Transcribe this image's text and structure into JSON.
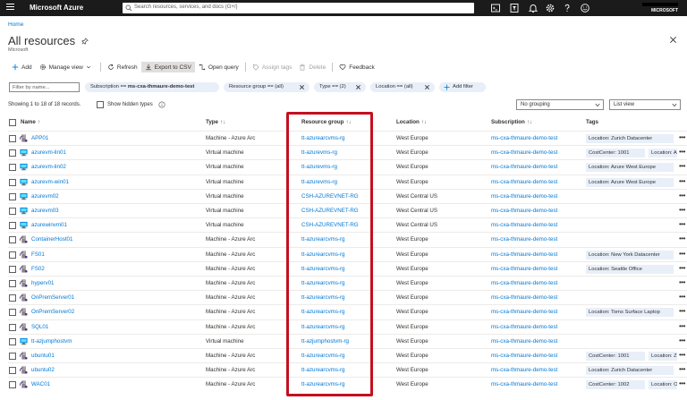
{
  "topbar": {
    "brand": "Microsoft Azure",
    "search_placeholder": "Search resources, services, and docs (G+/)",
    "tenant": "MICROSOFT"
  },
  "breadcrumb": "Home",
  "page": {
    "title": "All resources",
    "subtitle": "Microsoft"
  },
  "commands": {
    "add": "Add",
    "manage_view": "Manage view",
    "refresh": "Refresh",
    "export_csv": "Export to CSV",
    "open_query": "Open query",
    "assign_tags": "Assign tags",
    "delete": "Delete",
    "feedback": "Feedback"
  },
  "filters": {
    "placeholder": "Filter by name...",
    "subscription_label": "Subscription == ",
    "subscription_value": "ms-cxa-thmaure-demo-test",
    "resource_group": "Resource group == (all)",
    "type": "Type == (2)",
    "location": "Location == (all)",
    "add_filter": "Add filter"
  },
  "info": {
    "showing": "Showing 1 to 18 of 18 records.",
    "show_hidden": "Show hidden types",
    "grouping": "No grouping",
    "view": "List view"
  },
  "columns": {
    "name": "Name",
    "type": "Type",
    "resource_group": "Resource group",
    "location": "Location",
    "subscription": "Subscription",
    "tags": "Tags",
    "sort_glyph": "↑↓",
    "name_sort_glyph": "↑"
  },
  "rows": [
    {
      "name": "APP01",
      "type": "Machine - Azure Arc",
      "rg": "tt-azurearcvms-rg",
      "location": "West Europe",
      "sub": "ms-cxa-thmaure-demo-test",
      "tags": [
        "Location: Zurich Datacenter"
      ],
      "icon": "arc"
    },
    {
      "name": "azurevm-lin01",
      "type": "Virtual machine",
      "rg": "tt-azurevms-rg",
      "location": "West Europe",
      "sub": "ms-cxa-thmaure-demo-test",
      "tags": [
        "CostCenter: 1001",
        "Location: Az"
      ],
      "icon": "vm"
    },
    {
      "name": "azurevm-lin02",
      "type": "Virtual machine",
      "rg": "tt-azurevms-rg",
      "location": "West Europe",
      "sub": "ms-cxa-thmaure-demo-test",
      "tags": [
        "Location: Azure West Europe"
      ],
      "icon": "vm"
    },
    {
      "name": "azurevm-win01",
      "type": "Virtual machine",
      "rg": "tt-azurevms-rg",
      "location": "West Europe",
      "sub": "ms-cxa-thmaure-demo-test",
      "tags": [
        "Location: Azure West Europe"
      ],
      "icon": "vm"
    },
    {
      "name": "azurevm02",
      "type": "Virtual machine",
      "rg": "CSH-AZUREVNET-RG",
      "location": "West Central US",
      "sub": "ms-cxa-thmaure-demo-test",
      "tags": [],
      "icon": "vm"
    },
    {
      "name": "azurevm03",
      "type": "Virtual machine",
      "rg": "CSH-AZUREVNET-RG",
      "location": "West Central US",
      "sub": "ms-cxa-thmaure-demo-test",
      "tags": [],
      "icon": "vm"
    },
    {
      "name": "azurewinvm01",
      "type": "Virtual machine",
      "rg": "CSH-AZUREVNET-RG",
      "location": "West Central US",
      "sub": "ms-cxa-thmaure-demo-test",
      "tags": [],
      "icon": "vm"
    },
    {
      "name": "ContainerHost01",
      "type": "Machine - Azure Arc",
      "rg": "tt-azurearcvms-rg",
      "location": "West Europe",
      "sub": "ms-cxa-thmaure-demo-test",
      "tags": [],
      "icon": "arc"
    },
    {
      "name": "FS01",
      "type": "Machine - Azure Arc",
      "rg": "tt-azurearcvms-rg",
      "location": "West Europe",
      "sub": "ms-cxa-thmaure-demo-test",
      "tags": [
        "Location: New York Datacenter"
      ],
      "icon": "arc"
    },
    {
      "name": "FS02",
      "type": "Machine - Azure Arc",
      "rg": "tt-azurearcvms-rg",
      "location": "West Europe",
      "sub": "ms-cxa-thmaure-demo-test",
      "tags": [
        "Location: Seattle Office"
      ],
      "icon": "arc"
    },
    {
      "name": "hyperv01",
      "type": "Machine - Azure Arc",
      "rg": "tt-azurearcvms-rg",
      "location": "West Europe",
      "sub": "ms-cxa-thmaure-demo-test",
      "tags": [],
      "icon": "arc"
    },
    {
      "name": "OnPremServer01",
      "type": "Machine - Azure Arc",
      "rg": "tt-azurearcvms-rg",
      "location": "West Europe",
      "sub": "ms-cxa-thmaure-demo-test",
      "tags": [],
      "icon": "arc"
    },
    {
      "name": "OnPremServer02",
      "type": "Machine - Azure Arc",
      "rg": "tt-azurearcvms-rg",
      "location": "West Europe",
      "sub": "ms-cxa-thmaure-demo-test",
      "tags": [
        "Location: Toms Surface Laptop"
      ],
      "icon": "arc"
    },
    {
      "name": "SQL01",
      "type": "Machine - Azure Arc",
      "rg": "tt-azurearcvms-rg",
      "location": "West Europe",
      "sub": "ms-cxa-thmaure-demo-test",
      "tags": [],
      "icon": "arc"
    },
    {
      "name": "tt-azjumphostvm",
      "type": "Virtual machine",
      "rg": "tt-azjumphostvm-rg",
      "location": "West Europe",
      "sub": "ms-cxa-thmaure-demo-test",
      "tags": [],
      "icon": "vm"
    },
    {
      "name": "ubuntu01",
      "type": "Machine - Azure Arc",
      "rg": "tt-azurearcvms-rg",
      "location": "West Europe",
      "sub": "ms-cxa-thmaure-demo-test",
      "tags": [
        "CostCenter: 1001",
        "Location: Zu"
      ],
      "icon": "arc"
    },
    {
      "name": "ubuntu02",
      "type": "Machine - Azure Arc",
      "rg": "tt-azurearcvms-rg",
      "location": "West Europe",
      "sub": "ms-cxa-thmaure-demo-test",
      "tags": [
        "Location: Zurich Datacenter"
      ],
      "icon": "arc"
    },
    {
      "name": "WAC01",
      "type": "Machine - Azure Arc",
      "rg": "tt-azurearcvms-rg",
      "location": "West Europe",
      "sub": "ms-cxa-thmaure-demo-test",
      "tags": [
        "CostCenter: 1002",
        "Location: Ot"
      ],
      "icon": "arc"
    }
  ],
  "row_more_glyph": "•••",
  "colors": {
    "link": "#0078d4",
    "topbar": "#1b1b1b",
    "highlight": "#c50f1f",
    "pill": "#e8eff8"
  }
}
